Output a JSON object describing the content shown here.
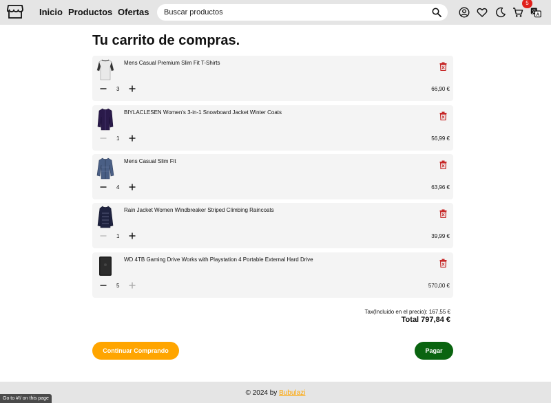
{
  "colors": {
    "header_bg": "#e5e5e5",
    "accent_orange": "#ffa500",
    "pay_green": "#0a6410",
    "trash_red": "#c62828",
    "badge_red": "#e0201b",
    "card_bg": "#f4f4f4"
  },
  "header": {
    "logo_icon": "store-icon",
    "nav": [
      "Inicio",
      "Productos",
      "Ofertas"
    ],
    "search": {
      "placeholder": "Buscar productos",
      "icon": "search-icon"
    },
    "icons": [
      "user-icon",
      "heart-icon",
      "moon-icon",
      "cart-icon",
      "translate-icon"
    ],
    "cart_count": "5"
  },
  "page_title": "Tu carrito de compras.",
  "items": [
    {
      "name": "Mens Casual Premium Slim Fit T-Shirts",
      "qty": "3",
      "price": "66,90 €",
      "minus_enabled": true,
      "plus_enabled": true
    },
    {
      "name": "BIYLACLESEN Women's 3-in-1 Snowboard Jacket Winter Coats",
      "qty": "1",
      "price": "56,99 €",
      "minus_enabled": false,
      "plus_enabled": true
    },
    {
      "name": "Mens Casual Slim Fit",
      "qty": "4",
      "price": "63,96 €",
      "minus_enabled": true,
      "plus_enabled": true
    },
    {
      "name": "Rain Jacket Women Windbreaker Striped Climbing Raincoats",
      "qty": "1",
      "price": "39,99 €",
      "minus_enabled": false,
      "plus_enabled": true
    },
    {
      "name": "WD 4TB Gaming Drive Works with Playstation 4 Portable External Hard Drive",
      "qty": "5",
      "price": "570,00 €",
      "minus_enabled": true,
      "plus_enabled": false
    }
  ],
  "summary": {
    "tax": "Tax(Incluido en el precio): 167,55 €",
    "total": "Total 797,84 €"
  },
  "buttons": {
    "continue": "Continuar Comprando",
    "pay": "Pagar"
  },
  "footer": {
    "text": "© 2024 by",
    "link": "Bubulazi"
  },
  "status_bar": "Go to #!/ on this page"
}
